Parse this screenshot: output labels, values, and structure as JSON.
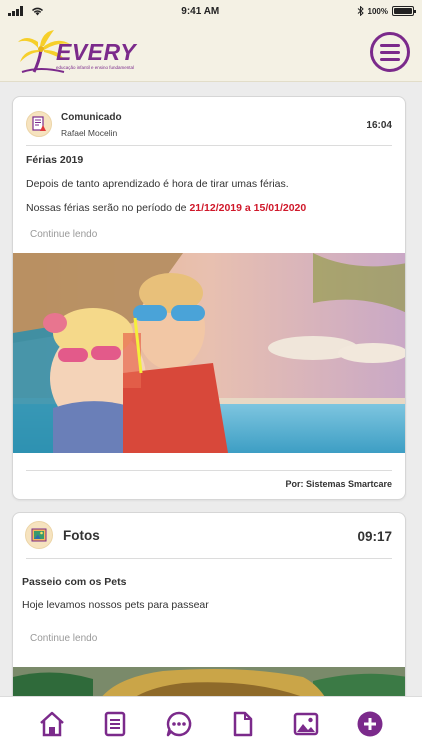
{
  "status_bar": {
    "time": "9:41 AM",
    "battery": "100%"
  },
  "header": {
    "logo_name": "EVERY",
    "logo_tagline": "educação infantil e ensino fundamental",
    "menu_icon": "hamburger-menu-icon"
  },
  "posts": [
    {
      "type_label": "Comunicado",
      "author": "Rafael Mocelin",
      "time": "16:04",
      "title": "Férias 2019",
      "body": "Depois de tanto aprendizado é hora de tirar umas férias.",
      "body2_prefix": "Nossas férias serão no período de",
      "body2_dates": "21/12/2019 a 15/01/2020",
      "continue_label": "Continue lendo",
      "footer": "Por: Sistemas Smartcare",
      "icon": "announcement-icon"
    },
    {
      "type_label": "Fotos",
      "time": "09:17",
      "title": "Passeio com os Pets",
      "body": "Hoje levamos nossos pets para passear",
      "continue_label": "Continue lendo",
      "icon": "photo-icon"
    }
  ],
  "tab_bar": [
    {
      "icon": "home-icon"
    },
    {
      "icon": "document-list-icon"
    },
    {
      "icon": "chat-icon"
    },
    {
      "icon": "file-icon"
    },
    {
      "icon": "gallery-icon"
    },
    {
      "icon": "add-icon"
    }
  ],
  "colors": {
    "brand_purple": "#7b2a8b",
    "date_red": "#d0192b",
    "header_bg": "#f4f1e4"
  }
}
